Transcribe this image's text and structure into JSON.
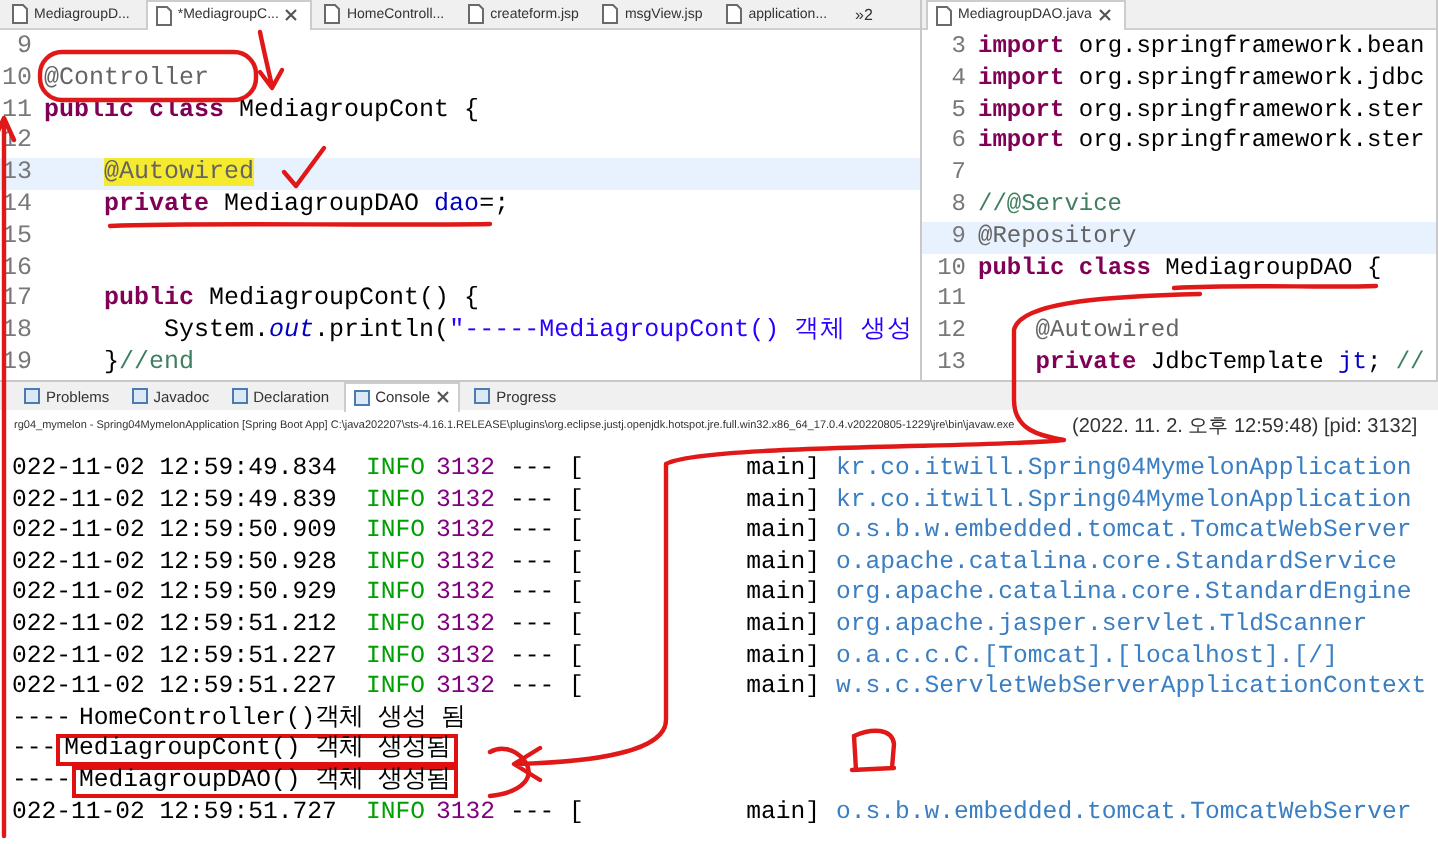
{
  "left_editor": {
    "tabs": [
      {
        "label": "MediagroupD...",
        "selected": false
      },
      {
        "label": "*MediagroupC...",
        "selected": true
      },
      {
        "label": "HomeControll...",
        "selected": false
      },
      {
        "label": "createform.jsp",
        "selected": false
      },
      {
        "label": "msgView.jsp",
        "selected": false
      },
      {
        "label": "application...",
        "selected": false
      }
    ],
    "overflow": "»2",
    "lines": [
      {
        "number": "9",
        "current": false
      },
      {
        "number": "10",
        "current": false,
        "tokens": [
          {
            "kind": "annotation",
            "text": "@Controller",
            "marked": false
          }
        ]
      },
      {
        "number": "11",
        "current": false,
        "tokens": [
          {
            "kind": "keyword",
            "text": "public",
            "marked": false
          },
          {
            "kind": "keyword",
            "text": " class",
            "marked": false
          },
          {
            "kind": "plain",
            "text": " MediagroupCont {",
            "marked": false
          }
        ]
      },
      {
        "number": "12",
        "current": false
      },
      {
        "number": "13",
        "current": true,
        "tokens": [
          {
            "kind": "annotation",
            "text": "    @Autowired",
            "marked": true
          }
        ]
      },
      {
        "number": "14",
        "current": false,
        "tokens": [
          {
            "kind": "keyword",
            "text": "    private",
            "marked": false
          },
          {
            "kind": "plain",
            "text": " MediagroupDAO ",
            "marked": false
          },
          {
            "kind": "field",
            "text": "dao",
            "marked": false
          },
          {
            "kind": "plain",
            "text": "=;",
            "marked": false
          }
        ]
      },
      {
        "number": "15",
        "current": false
      },
      {
        "number": "16",
        "current": false
      },
      {
        "number": "17",
        "current": false,
        "tokens": [
          {
            "kind": "keyword",
            "text": "    public",
            "marked": false
          },
          {
            "kind": "plain",
            "text": " MediagroupCont() {",
            "marked": false
          }
        ]
      },
      {
        "number": "18",
        "current": false,
        "tokens": [
          {
            "kind": "plain",
            "text": "        System.",
            "marked": false
          },
          {
            "kind": "static",
            "text": "out",
            "marked": false
          },
          {
            "kind": "plain",
            "text": ".println(",
            "marked": false
          },
          {
            "kind": "string",
            "text": "\"-----MediagroupCont() 객체 생성",
            "marked": false
          }
        ]
      },
      {
        "number": "19",
        "current": false,
        "tokens": [
          {
            "kind": "plain",
            "text": "    }",
            "marked": false
          },
          {
            "kind": "comment",
            "text": "//end",
            "marked": false
          }
        ]
      }
    ]
  },
  "right_editor": {
    "tabs": [
      {
        "label": "MediagroupDAO.java",
        "selected": true
      }
    ],
    "lines": [
      {
        "number": "3",
        "current": false,
        "tokens": [
          {
            "kind": "keyword",
            "text": "import",
            "marked": false
          },
          {
            "kind": "plain",
            "text": " org.springframework.bean",
            "marked": false
          }
        ]
      },
      {
        "number": "4",
        "current": false,
        "tokens": [
          {
            "kind": "keyword",
            "text": "import",
            "marked": false
          },
          {
            "kind": "plain",
            "text": " org.springframework.jdbc",
            "marked": false
          }
        ]
      },
      {
        "number": "5",
        "current": false,
        "tokens": [
          {
            "kind": "keyword",
            "text": "import",
            "marked": false
          },
          {
            "kind": "plain",
            "text": " org.springframework.ster",
            "marked": false
          }
        ]
      },
      {
        "number": "6",
        "current": false,
        "tokens": [
          {
            "kind": "keyword",
            "text": "import",
            "marked": false
          },
          {
            "kind": "plain",
            "text": " org.springframework.ster",
            "marked": false
          }
        ]
      },
      {
        "number": "7",
        "current": false
      },
      {
        "number": "8",
        "current": false,
        "tokens": [
          {
            "kind": "comment",
            "text": "//@Service",
            "marked": false
          }
        ]
      },
      {
        "number": "9",
        "current": true,
        "tokens": [
          {
            "kind": "annotation",
            "text": "@Repository",
            "marked": false
          }
        ]
      },
      {
        "number": "10",
        "current": false,
        "tokens": [
          {
            "kind": "keyword",
            "text": "public",
            "marked": false
          },
          {
            "kind": "keyword",
            "text": " class",
            "marked": false
          },
          {
            "kind": "plain",
            "text": " MediagroupDAO {",
            "marked": false
          }
        ]
      },
      {
        "number": "11",
        "current": false
      },
      {
        "number": "12",
        "current": false,
        "tokens": [
          {
            "kind": "annotation",
            "text": "    @Autowired",
            "marked": false
          }
        ]
      },
      {
        "number": "13",
        "current": false,
        "tokens": [
          {
            "kind": "keyword",
            "text": "    private",
            "marked": false
          },
          {
            "kind": "plain",
            "text": " JdbcTemplate ",
            "marked": false
          },
          {
            "kind": "field",
            "text": "jt",
            "marked": false
          },
          {
            "kind": "plain",
            "text": "; ",
            "marked": false
          },
          {
            "kind": "comment",
            "text": "//",
            "marked": false
          }
        ]
      }
    ]
  },
  "console": {
    "tabs": [
      {
        "label": "Problems",
        "selected": false
      },
      {
        "label": "Javadoc",
        "selected": false
      },
      {
        "label": "Declaration",
        "selected": false
      },
      {
        "label": "Console",
        "selected": true
      },
      {
        "label": "Progress",
        "selected": false
      }
    ],
    "launch_path": "rg04_mymelon - Spring04MymelonApplication [Spring Boot App] C:\\java202207\\sts-4.16.1.RELEASE\\plugins\\org.eclipse.justj.openjdk.hotspot.jre.full.win32.x86_64_17.0.4.v20220805-1229\\jre\\bin\\javaw.exe",
    "launch_time": "(2022. 11. 2. 오후 12:59:48) [pid: 3132]",
    "rows": [
      {
        "kind": "log",
        "time": "022-11-02 12:59:49.834",
        "level": "INFO",
        "pid": "3132",
        "separator": "--- [",
        "thread": "main]",
        "logger": "kr.co.itwill.Spring04MymelonApplication"
      },
      {
        "kind": "log",
        "time": "022-11-02 12:59:49.839",
        "level": "INFO",
        "pid": "3132",
        "separator": "--- [",
        "thread": "main]",
        "logger": "kr.co.itwill.Spring04MymelonApplication"
      },
      {
        "kind": "log",
        "time": "022-11-02 12:59:50.909",
        "level": "INFO",
        "pid": "3132",
        "separator": "--- [",
        "thread": "main]",
        "logger": "o.s.b.w.embedded.tomcat.TomcatWebServer"
      },
      {
        "kind": "log",
        "time": "022-11-02 12:59:50.928",
        "level": "INFO",
        "pid": "3132",
        "separator": "--- [",
        "thread": "main]",
        "logger": "o.apache.catalina.core.StandardService"
      },
      {
        "kind": "log",
        "time": "022-11-02 12:59:50.929",
        "level": "INFO",
        "pid": "3132",
        "separator": "--- [",
        "thread": "main]",
        "logger": "org.apache.catalina.core.StandardEngine"
      },
      {
        "kind": "log",
        "time": "022-11-02 12:59:51.212",
        "level": "INFO",
        "pid": "3132",
        "separator": "--- [",
        "thread": "main]",
        "logger": "org.apache.jasper.servlet.TldScanner"
      },
      {
        "kind": "log",
        "time": "022-11-02 12:59:51.227",
        "level": "INFO",
        "pid": "3132",
        "separator": "--- [",
        "thread": "main]",
        "logger": "o.a.c.c.C.[Tomcat].[localhost].[/]"
      },
      {
        "kind": "log",
        "time": "022-11-02 12:59:51.227",
        "level": "INFO",
        "pid": "3132",
        "separator": "--- [",
        "thread": "main]",
        "logger": "w.s.c.ServletWebServerApplicationContext"
      },
      {
        "kind": "out",
        "prefix": "----",
        "text": "HomeController()객체 생성 됨",
        "boxed": false
      },
      {
        "kind": "out",
        "prefix": "---",
        "text": "MediagroupCont() 객체 생성됨",
        "boxed": true
      },
      {
        "kind": "out",
        "prefix": "----",
        "text": "MediagroupDAO() 객체 생성됨",
        "boxed": true
      },
      {
        "kind": "log",
        "time": "022-11-02 12:59:51.727",
        "level": "INFO",
        "pid": "3132",
        "separator": "--- [",
        "thread": "main]",
        "logger": "o.s.b.w.embedded.tomcat.TomcatWebServer"
      }
    ]
  }
}
